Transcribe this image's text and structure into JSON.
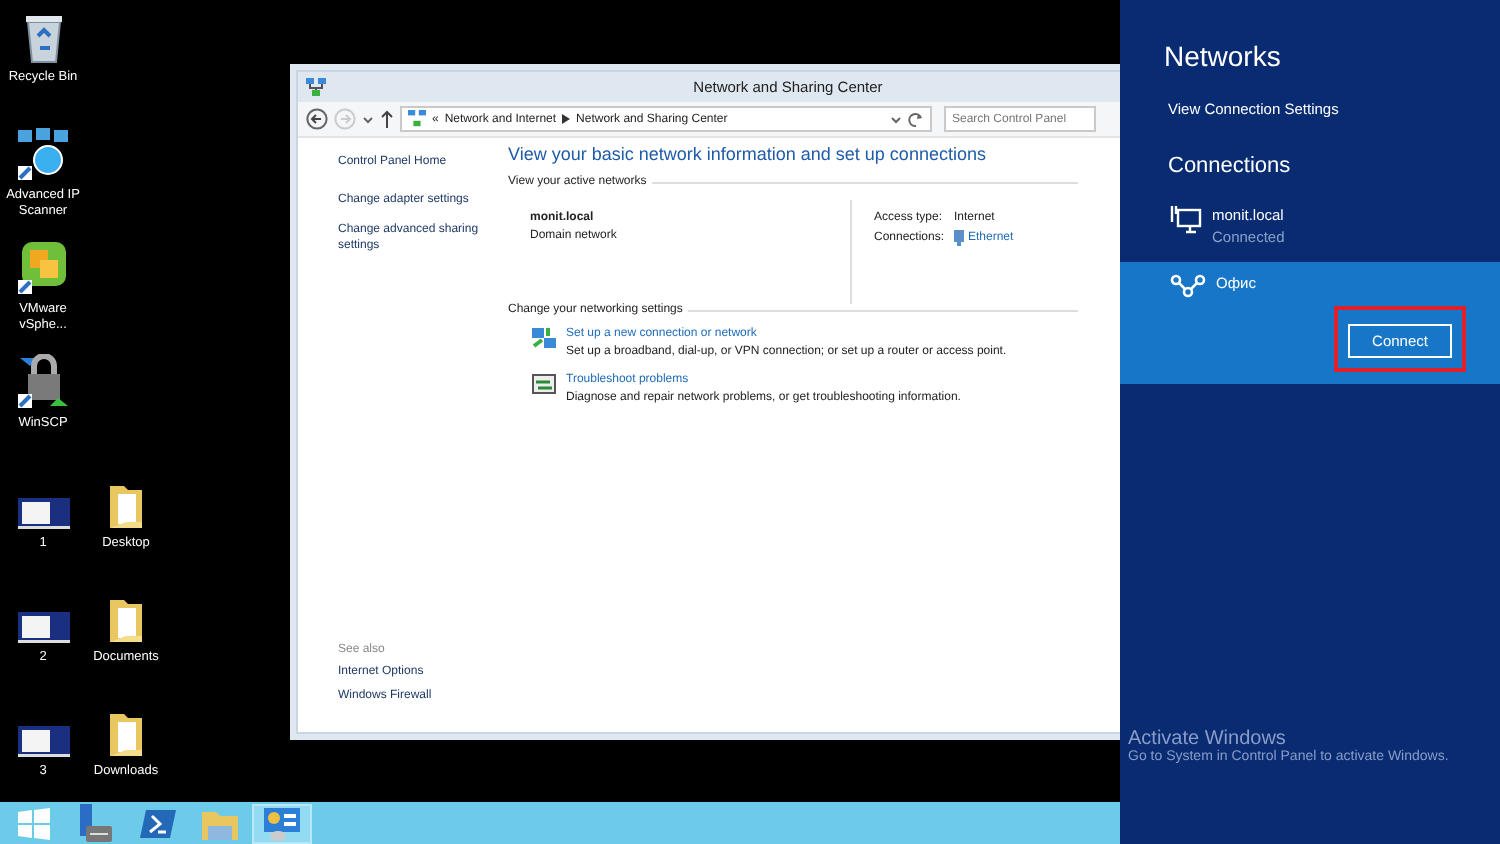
{
  "desktop": {
    "rows": [
      [
        {
          "label": "Recycle Bin",
          "kind": "recycle"
        }
      ],
      [
        {
          "label": "Advanced IP Scanner",
          "kind": "scanner"
        }
      ],
      [
        {
          "label": "VMware vSphe...",
          "kind": "vmware"
        }
      ],
      [
        {
          "label": "WinSCP",
          "kind": "winscp"
        }
      ],
      [
        {
          "label": "1",
          "kind": "thumbnail"
        },
        {
          "label": "Desktop",
          "kind": "folder"
        }
      ],
      [
        {
          "label": "2",
          "kind": "thumbnail"
        },
        {
          "label": "Documents",
          "kind": "folder"
        }
      ],
      [
        {
          "label": "3",
          "kind": "thumbnail"
        },
        {
          "label": "Downloads",
          "kind": "folder"
        }
      ]
    ]
  },
  "window": {
    "title": "Network and Sharing Center",
    "address": {
      "prefix": "«",
      "crumbs": [
        "Network and Internet",
        "Network and Sharing Center"
      ]
    },
    "search": {
      "placeholder": "Search Control Panel"
    },
    "sidebar": {
      "items": [
        "Control Panel Home",
        "Change adapter settings",
        "Change advanced sharing settings"
      ],
      "see_also_heading": "See also",
      "see_also": [
        "Internet Options",
        "Windows Firewall"
      ]
    },
    "heading": "View your basic network information and set up connections",
    "active_networks": {
      "heading": "View your active networks",
      "name": "monit.local",
      "type": "Domain network",
      "access_label": "Access type:",
      "access_value": "Internet",
      "connections_label": "Connections:",
      "connections_value": "Ethernet"
    },
    "settings": {
      "heading": "Change your networking settings",
      "tasks": [
        {
          "kind": "setup",
          "title": "Set up a new connection or network",
          "description": "Set up a broadband, dial-up, or VPN connection; or set up a router or access point."
        },
        {
          "kind": "troubleshoot",
          "title": "Troubleshoot problems",
          "description": "Diagnose and repair network problems, or get troubleshooting information."
        }
      ]
    }
  },
  "taskbar": {
    "items": [
      {
        "kind": "start",
        "selected": false
      },
      {
        "kind": "server",
        "selected": false
      },
      {
        "kind": "powershell",
        "selected": false
      },
      {
        "kind": "explorer",
        "selected": false
      },
      {
        "kind": "control-panel",
        "selected": true
      }
    ]
  },
  "networks_panel": {
    "title": "Networks",
    "settings_link": "View Connection Settings",
    "connections_heading": "Connections",
    "connections": [
      {
        "kind": "wired",
        "name": "monit.local",
        "status": "Connected",
        "selected": false
      },
      {
        "kind": "wireless",
        "name": "Офис",
        "selected": true
      }
    ],
    "connect_button": "Connect",
    "highlighted": true
  },
  "activation": {
    "title": "Activate Windows",
    "message": "Go to System in Control Panel to activate Windows."
  }
}
